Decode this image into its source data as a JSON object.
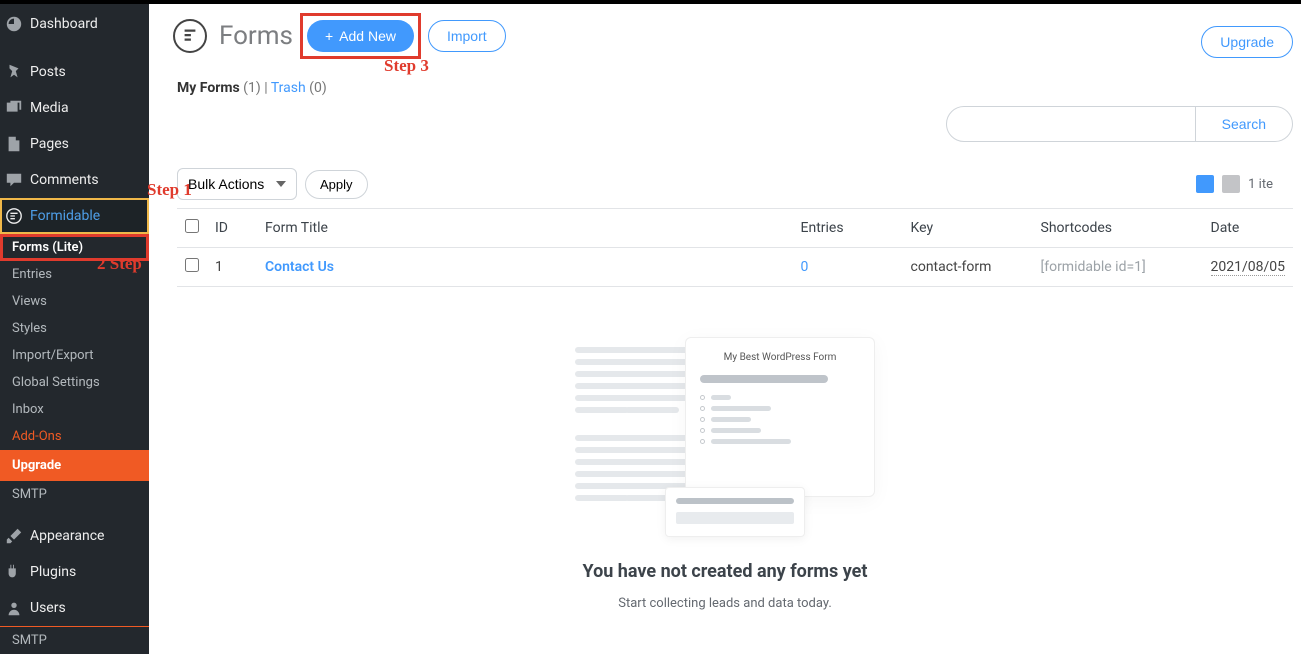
{
  "sidebar": {
    "items": [
      {
        "label": "Dashboard",
        "icon": "dashboard-icon"
      },
      {
        "label": "Posts",
        "icon": "pin-icon"
      },
      {
        "label": "Media",
        "icon": "media-icon"
      },
      {
        "label": "Pages",
        "icon": "page-icon"
      },
      {
        "label": "Comments",
        "icon": "comment-icon"
      },
      {
        "label": "Formidable",
        "icon": "formidable-icon"
      }
    ],
    "sub": [
      {
        "label": "Forms (Lite)"
      },
      {
        "label": "Entries"
      },
      {
        "label": "Views"
      },
      {
        "label": "Styles"
      },
      {
        "label": "Import/Export"
      },
      {
        "label": "Global Settings"
      },
      {
        "label": "Inbox"
      },
      {
        "label": "Add-Ons"
      },
      {
        "label": "Upgrade"
      },
      {
        "label": "SMTP"
      }
    ],
    "items2": [
      {
        "label": "Appearance",
        "icon": "brush-icon"
      },
      {
        "label": "Plugins",
        "icon": "plugins-icon"
      },
      {
        "label": "Users",
        "icon": "users-icon"
      }
    ],
    "sub2": [
      {
        "label": "SMTP"
      }
    ]
  },
  "annotations": {
    "step1": "Step 1",
    "step2": "2 Step",
    "step3": "Step 3"
  },
  "header": {
    "title": "Forms",
    "add_new": "Add New",
    "import": "Import",
    "upgrade": "Upgrade"
  },
  "subsubsub": {
    "my_forms": "My Forms",
    "my_forms_count": "(1)",
    "sep": " | ",
    "trash": "Trash",
    "trash_count": "(0)"
  },
  "toolbar": {
    "bulk": "Bulk Actions",
    "apply": "Apply",
    "item_count": "1 ite"
  },
  "search": {
    "placeholder": "",
    "button": "Search"
  },
  "table": {
    "columns": {
      "id": "ID",
      "title": "Form Title",
      "entries": "Entries",
      "key": "Key",
      "shortcodes": "Shortcodes",
      "date": "Date"
    },
    "rows": [
      {
        "id": "1",
        "title": "Contact Us",
        "entries": "0",
        "key": "contact-form",
        "shortcodes": "[formidable id=1]",
        "date": "2021/08/05"
      }
    ]
  },
  "empty": {
    "illus_title": "My Best WordPress Form",
    "heading": "You have not created any forms yet",
    "subtext": "Start collecting leads and data today."
  }
}
